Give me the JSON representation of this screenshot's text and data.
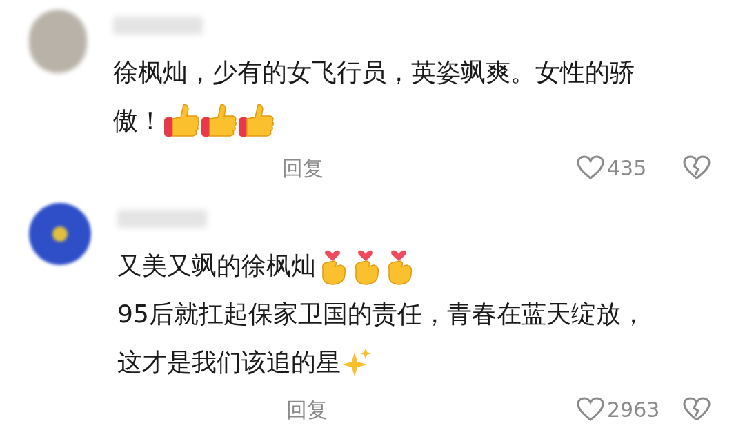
{
  "comments": [
    {
      "avatar": {
        "kind": "photo"
      },
      "lines": [
        [
          {
            "kind": "text",
            "text": "徐枫灿，少有的女飞行员，英姿飒爽。女性的骄"
          }
        ],
        [
          {
            "kind": "text",
            "text": "傲！"
          },
          {
            "kind": "thumbsup"
          },
          {
            "kind": "thumbsup"
          },
          {
            "kind": "thumbsup"
          }
        ]
      ],
      "reply": "回复",
      "likes": "435"
    },
    {
      "avatar": {
        "kind": "badge"
      },
      "lines": [
        [
          {
            "kind": "text",
            "text": "又美又飒的徐枫灿"
          },
          {
            "kind": "fingerheart"
          },
          {
            "kind": "fingerheart"
          },
          {
            "kind": "fingerheart"
          }
        ],
        [
          {
            "kind": "text",
            "text": "95后就扛起保家卫国的责任，青春在蓝天绽放，"
          }
        ],
        [
          {
            "kind": "text",
            "text": "这才是我们该追的星"
          },
          {
            "kind": "sparkles"
          }
        ]
      ],
      "reply": "回复",
      "likes": "2963"
    }
  ]
}
